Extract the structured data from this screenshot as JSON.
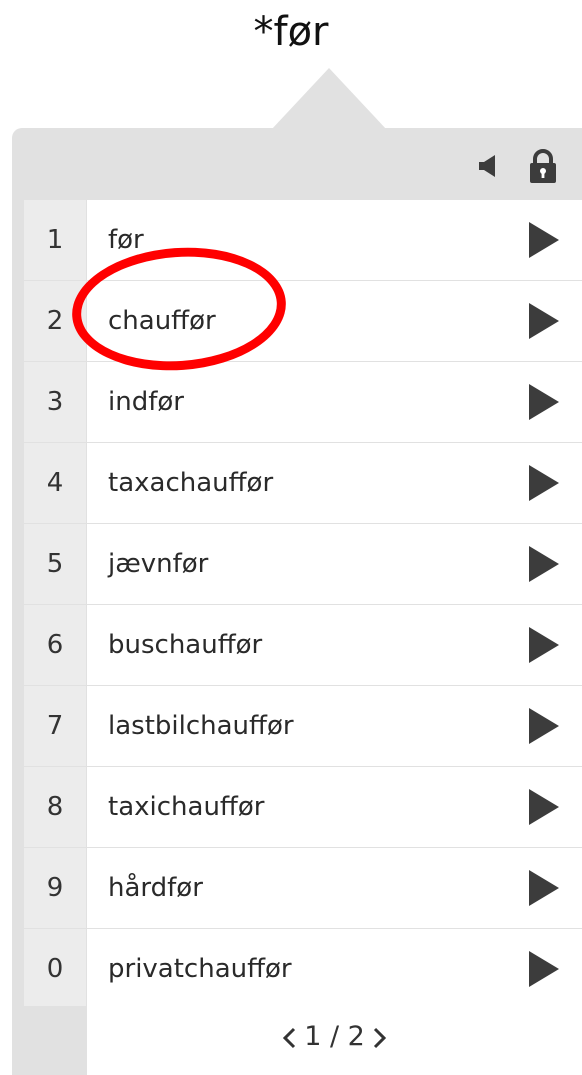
{
  "query": "*før",
  "toolbar": {
    "speaker_icon": "speaker-icon",
    "lock_icon": "lock-icon"
  },
  "items": [
    {
      "num": "1",
      "word": "før"
    },
    {
      "num": "2",
      "word": "chauffør"
    },
    {
      "num": "3",
      "word": "indfør"
    },
    {
      "num": "4",
      "word": "taxachauffør"
    },
    {
      "num": "5",
      "word": "jævnfør"
    },
    {
      "num": "6",
      "word": "buschauffør"
    },
    {
      "num": "7",
      "word": "lastbilchauffør"
    },
    {
      "num": "8",
      "word": "taxichauffør"
    },
    {
      "num": "9",
      "word": "hårdfør"
    },
    {
      "num": "0",
      "word": "privatchauffør"
    }
  ],
  "pager": {
    "text": "1 / 2",
    "prev_icon": "chevron-left-icon",
    "next_icon": "chevron-right-icon"
  },
  "annotation": {
    "highlighted_item": "2",
    "color": "#ff0000"
  },
  "colors": {
    "panel_bg": "#e1e1e1",
    "number_bg": "#ececec",
    "row_bg": "#ffffff",
    "icon": "#3c3c3c"
  }
}
